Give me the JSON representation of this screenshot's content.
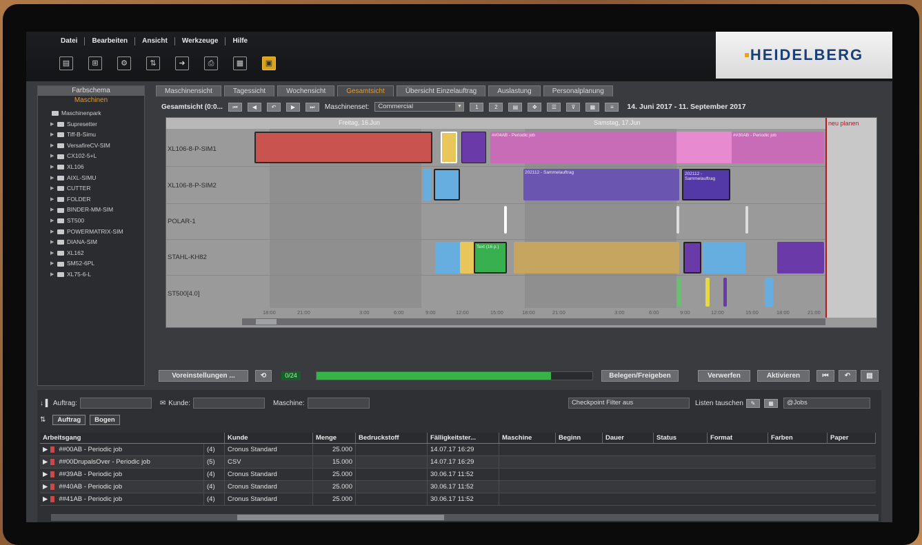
{
  "menu": [
    "Datei",
    "Bearbeiten",
    "Ansicht",
    "Werkzeuge",
    "Hilfe"
  ],
  "brand": "HEIDELBERG",
  "left_panel": {
    "title": "Farbschema",
    "subtitle": "Maschinen",
    "root": "Maschinenpark",
    "items": [
      "Supresetter",
      "Tiff-B-Simu",
      "VersafireCV-SIM",
      "CX102-5+L",
      "XL106",
      "AIXL-SIMU",
      "CUTTER",
      "FOLDER",
      "BINDER-MM-SIM",
      "ST500",
      "POWERMATRIX-SIM",
      "DIANA-SIM",
      "XL162",
      "SM52-6PL",
      "XL75-6-L"
    ]
  },
  "tabs": [
    "Maschinensicht",
    "Tagessicht",
    "Wochensicht",
    "Gesamtsicht",
    "Übersicht Einzelauftrag",
    "Auslastung",
    "Personalplanung"
  ],
  "active_tab": "Gesamtsicht",
  "viewbar": {
    "label": "Gesamtsicht (0:0...",
    "machineset_label": "Maschinenset:",
    "machineset_value": "Commercial",
    "date_range": "14. Juni 2017 - 11. September 2017"
  },
  "gantt": {
    "day1": "Freitag, 16.Jun",
    "day2": "Samstag, 17.Jun",
    "red_label": "neu planen",
    "rows": [
      "XL106-8-P-SIM1",
      "XL106-8-P-SIM2",
      "POLAR-1",
      "STAHL-KH82",
      "ST500[4.0]"
    ],
    "ticks": [
      "18:00",
      "21:00",
      "3:00",
      "6:00",
      "9:00",
      "12:00",
      "15:00",
      "18:00",
      "21:00",
      "3:00",
      "6:00",
      "9:00",
      "12:00",
      "15:00",
      "18:00",
      "21:00"
    ],
    "bar_labels": [
      "##04AB - Periodic job",
      "##30AB - Periodic job",
      "202112 - Sammelauftrag",
      "202112 - Sammelauftrag",
      "Text (16 p.)"
    ]
  },
  "actions": {
    "settings": "Voreinstellungen ...",
    "counter": "0/24",
    "progress_fraction": 0.85,
    "release": "Belegen/Freigeben",
    "discard": "Verwerfen",
    "refresh": "Aktivieren"
  },
  "filters": {
    "order": "Auftrag:",
    "customer": "Kunde:",
    "machine": "Maschine:",
    "checkpoint": "Checkpoint Filter aus",
    "swap_lists": "Listen tauschen",
    "jobs": "@Jobs"
  },
  "sort": [
    "Auftrag",
    "Bogen"
  ],
  "table": {
    "headers": [
      "Arbeitsgang",
      "Kunde",
      "Menge",
      "Bedruckstoff",
      "Fälligkeitster...",
      "Maschine",
      "Beginn",
      "Dauer",
      "Status",
      "Format",
      "Farben",
      "Paper"
    ],
    "rows": [
      {
        "job": "##00AB - Periodic job",
        "count": "(4)",
        "kunde": "Cronus Standard",
        "menge": "25.000",
        "faellig": "14.07.17 16:29"
      },
      {
        "job": "##00DrupalsOver - Periodic job",
        "count": "(5)",
        "kunde": "CSV",
        "menge": "15.000",
        "faellig": "14.07.17 16:29"
      },
      {
        "job": "##39AB - Periodic job",
        "count": "(4)",
        "kunde": "Cronus Standard",
        "menge": "25.000",
        "faellig": "30.06.17 11:52"
      },
      {
        "job": "##40AB - Periodic job",
        "count": "(4)",
        "kunde": "Cronus Standard",
        "menge": "25.000",
        "faellig": "30.06.17 11:52"
      },
      {
        "job": "##41AB - Periodic job",
        "count": "(4)",
        "kunde": "Cronus Standard",
        "menge": "25.000",
        "faellig": "30.06.17 11:52"
      }
    ]
  },
  "colors": {
    "accent": "#e39a2a",
    "brand": "#1b3e76",
    "progress": "#37b34a",
    "alert": "#c0121f"
  }
}
